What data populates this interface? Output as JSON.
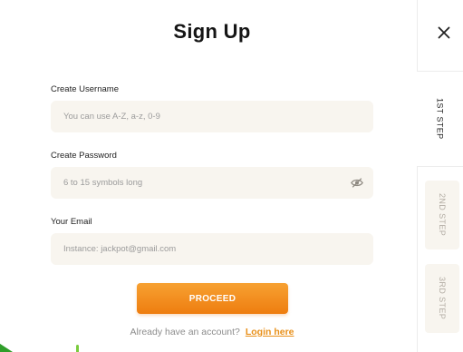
{
  "modal": {
    "title": "Sign Up",
    "username": {
      "label": "Create Username",
      "placeholder": "You can use A-Z, a-z, 0-9",
      "value": ""
    },
    "password": {
      "label": "Create Password",
      "placeholder": "6 to 15 symbols long",
      "value": "",
      "toggle_icon": "eye-slash-icon"
    },
    "email": {
      "label": "Your Email",
      "placeholder": "Instance: jackpot@gmail.com",
      "value": ""
    },
    "proceed_label": "PROCEED",
    "footer": {
      "text": "Already have an account?",
      "link": "Login here"
    }
  },
  "rail": {
    "close_icon": "close-icon",
    "steps": [
      {
        "label": "1ST STEP",
        "active": true
      },
      {
        "label": "2ND STEP",
        "active": false
      },
      {
        "label": "3RD STEP",
        "active": false
      }
    ]
  },
  "colors": {
    "accent": "#F08A1E",
    "field_bg": "#F8F5EF",
    "link": "#E8901A",
    "inactive_step_text": "#B2ACA3"
  }
}
